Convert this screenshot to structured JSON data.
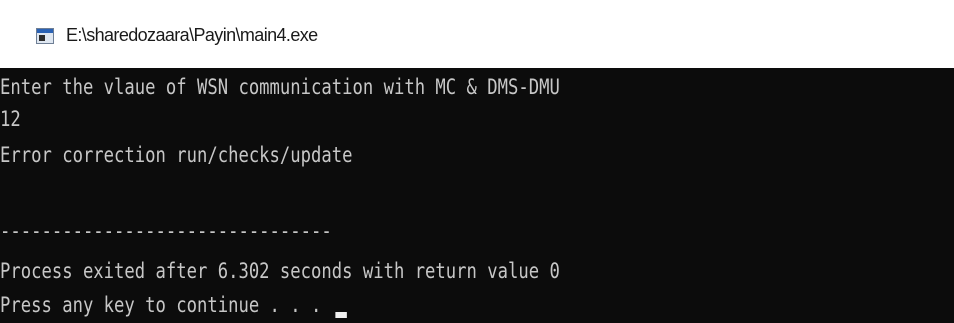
{
  "window": {
    "title": "E:\\sharedozaara\\Payin\\main4.exe",
    "icon": "console-app-icon"
  },
  "console": {
    "lines": [
      "Enter the vlaue of WSN communication with MC & DMS-DMU",
      "12",
      "Error correction run/checks/update",
      "",
      "--------------------------------",
      "Process exited after 6.302 seconds with return value 0",
      "Press any key to continue . . . "
    ],
    "colors": {
      "background": "#0c0c0c",
      "text": "#c7c7c7"
    }
  }
}
